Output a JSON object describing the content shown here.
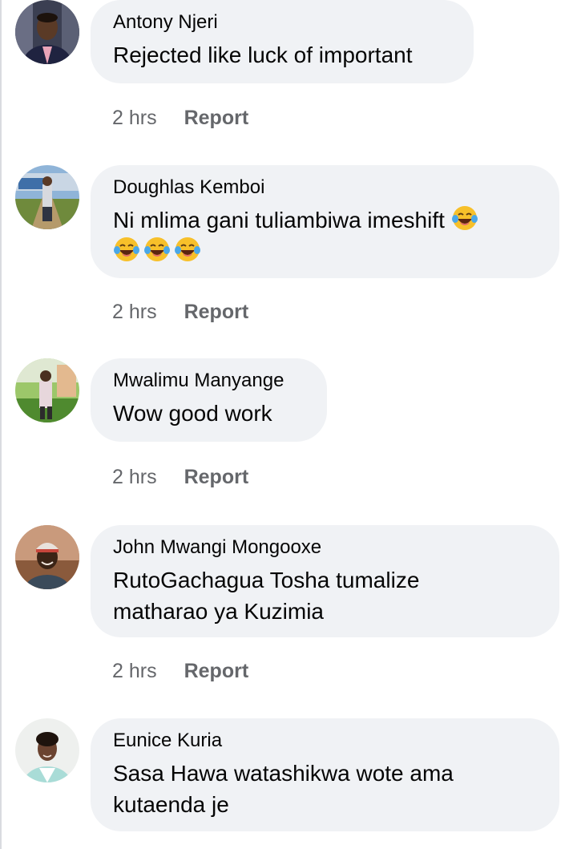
{
  "comments": [
    {
      "author": "Antony Njeri",
      "text": "Rejected like luck of important",
      "time": "2 hrs",
      "report_label": "Report"
    },
    {
      "author": "Doughlas Kemboi",
      "text": "Ni mlima gani tuliambiwa imeshift",
      "emojis": [
        "face-with-tears-of-joy",
        "face-with-tears-of-joy",
        "face-with-tears-of-joy",
        "face-with-tears-of-joy"
      ],
      "time": "2 hrs",
      "report_label": "Report"
    },
    {
      "author": "Mwalimu Manyange",
      "text": "Wow good work",
      "time": "2 hrs",
      "report_label": "Report"
    },
    {
      "author": "John Mwangi Mongooxe",
      "text": "RutoGachagua Tosha tumalize matharao ya Kuzimia",
      "time": "2 hrs",
      "report_label": "Report"
    },
    {
      "author": "Eunice Kuria",
      "text": "Sasa Hawa watashikwa wote ama kutaenda je"
    }
  ],
  "colors": {
    "bubble_background": "#f0f2f5",
    "meta_text": "#65676b",
    "primary_text": "#050505"
  }
}
